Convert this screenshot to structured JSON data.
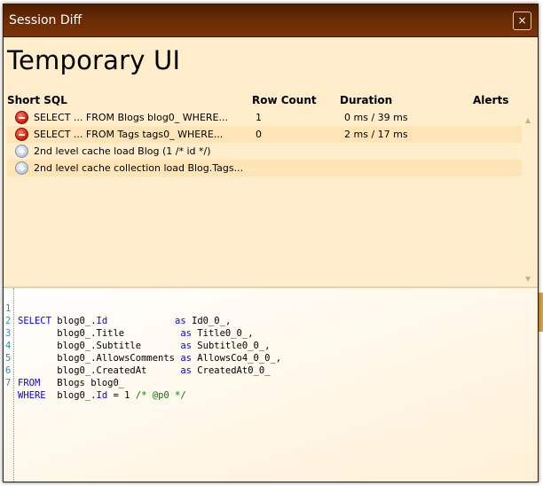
{
  "window": {
    "title": "Session Diff",
    "close_label": "×"
  },
  "main": {
    "title": "Temporary UI"
  },
  "table": {
    "headers": {
      "sql": "Short SQL",
      "rows": "Row Count",
      "duration": "Duration",
      "alerts": "Alerts"
    },
    "rows": [
      {
        "icon": "stop-icon",
        "sql": "SELECT ... FROM Blogs blog0_ WHERE...",
        "rows": "1",
        "duration": "0 ms / 39 ms"
      },
      {
        "icon": "stop-icon",
        "sql": "SELECT ... FROM Tags tags0_ WHERE...",
        "rows": "0",
        "duration": "2 ms / 17 ms"
      },
      {
        "icon": "info-icon",
        "sql": "2nd level cache load Blog (1 /* id */)",
        "rows": "",
        "duration": ""
      },
      {
        "icon": "info-icon",
        "sql": "2nd level cache collection load Blog.Tags...",
        "rows": "",
        "duration": ""
      }
    ],
    "scroll_up": "▲",
    "scroll_down": "▼"
  },
  "colors": {
    "titlebar": "#6a2a05",
    "panel": "#ffedcc",
    "alt_row": "#ffe4b8",
    "keyword": "#0000ff",
    "comment": "#008000",
    "line_number": "#2b91af"
  },
  "code": {
    "line_numbers": [
      "1",
      "2",
      "3",
      "4",
      "5",
      "6",
      "7"
    ],
    "l1": {
      "kw": "SELECT",
      "a": " blog0_.",
      "b": "Id",
      "pad": "            ",
      "as": "as",
      "rest": " Id0_0_,"
    },
    "l2": {
      "lead": "       blog0_.Title          ",
      "as": "as",
      "rest": " Title0_0_,"
    },
    "l3": {
      "lead": "       blog0_.Subtitle       ",
      "as": "as",
      "rest": " Subtitle0_0_,"
    },
    "l4": {
      "lead": "       blog0_.AllowsComments ",
      "as": "as",
      "rest": " AllowsCo4_0_0_,"
    },
    "l5": {
      "lead": "       blog0_.CreatedAt      ",
      "as": "as",
      "rest": " CreatedAt0_0_"
    },
    "l6": {
      "kw": "FROM",
      "rest": "   Blogs blog0_"
    },
    "l7": {
      "kw": "WHERE",
      "a": "  blog0_.",
      "b": "Id",
      "c": " = 1 ",
      "cm": "/* @p0 */"
    }
  }
}
